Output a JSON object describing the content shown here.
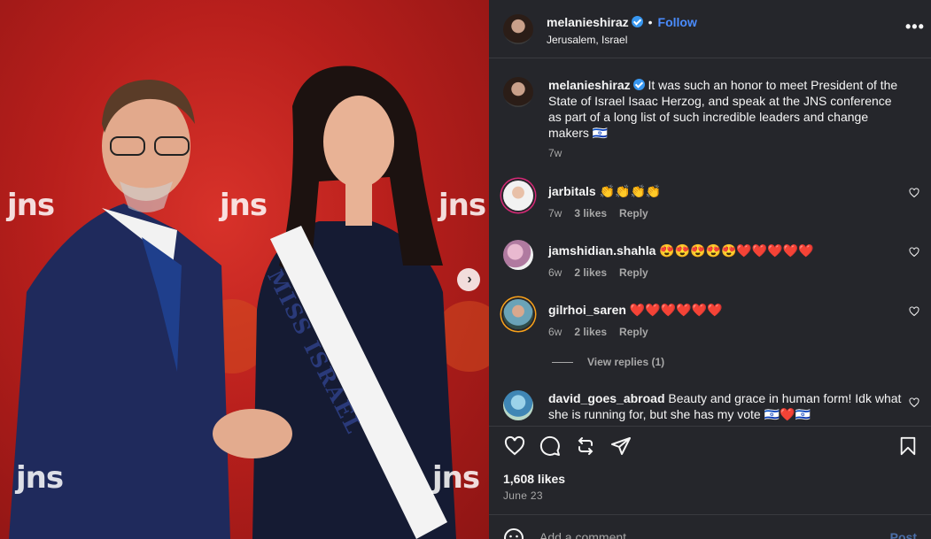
{
  "post": {
    "username": "melanieshiraz",
    "follow_label": "Follow",
    "location": "Jerusalem, Israel",
    "more_glyph": "•••"
  },
  "photo": {
    "watermarks": [
      "jns",
      "jns",
      "jns",
      "jns",
      "jns"
    ],
    "sash_text": "MISS ISRAEL",
    "next_glyph": "›"
  },
  "caption": {
    "username": "melanieshiraz",
    "text": "It was such an honor to meet President of the State of Israel Isaac Herzog, and speak at the JNS conference as part of a long list of such incredible leaders and change makers 🇮🇱",
    "time": "7w"
  },
  "comments": [
    {
      "username": "jarbitals",
      "text": "👏👏👏👏",
      "time": "7w",
      "likes": "3 likes",
      "reply": "Reply"
    },
    {
      "username": "jamshidian.shahla",
      "text": "😍😍😍😍😍❤️❤️❤️❤️❤️",
      "time": "6w",
      "likes": "2 likes",
      "reply": "Reply"
    },
    {
      "username": "gilrhoi_saren",
      "text": "❤️❤️❤️❤️❤️❤️",
      "time": "6w",
      "likes": "2 likes",
      "reply": "Reply"
    },
    {
      "username": "david_goes_abroad",
      "text": "Beauty and grace in human form! Idk what she is running for, but she has my vote 🇮🇱❤️🇮🇱"
    }
  ],
  "view_replies": "View replies (1)",
  "stats": {
    "likes": "1,608 likes",
    "date": "June 23"
  },
  "composer": {
    "placeholder": "Add a comment...",
    "post_label": "Post"
  },
  "colors": {
    "panel_bg": "#25262b",
    "accent": "#4a8cff",
    "verified": "#3897f0",
    "photo_red": "#c4231f"
  },
  "icons": [
    "heart-icon",
    "comment-icon",
    "share-icon",
    "send-icon",
    "bookmark-icon",
    "emoji-icon",
    "verified-icon",
    "more-icon",
    "chevron-right-icon"
  ]
}
